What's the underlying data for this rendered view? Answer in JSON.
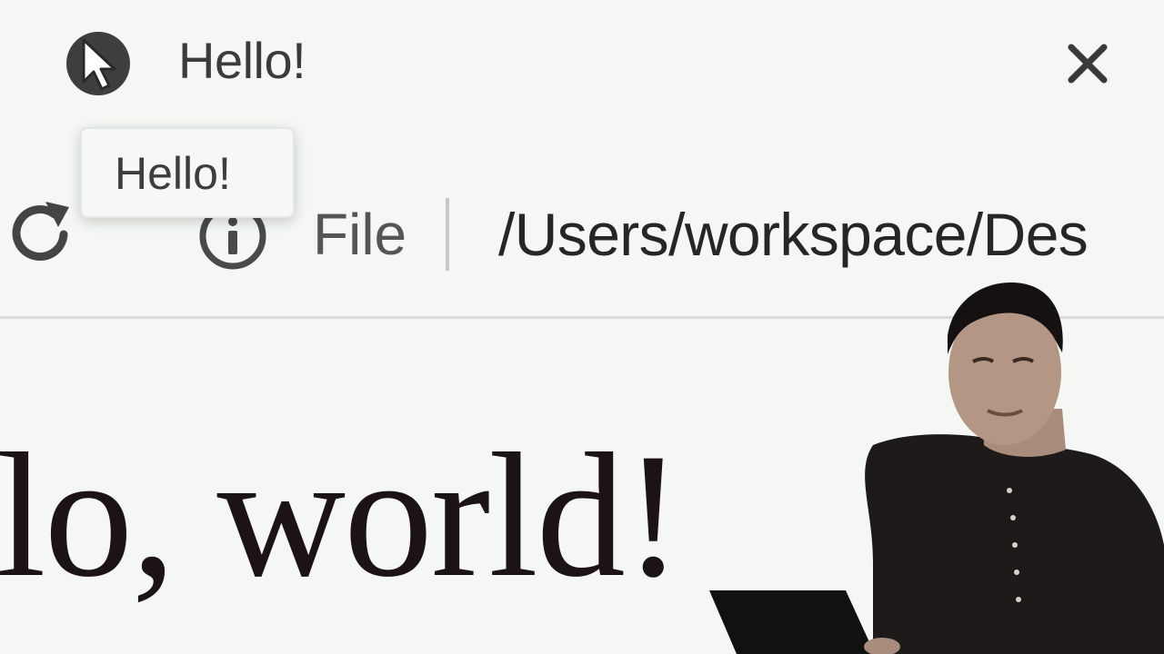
{
  "tab": {
    "title": "Hello!",
    "favicon": "cursor-pointer-icon",
    "close": "close-icon"
  },
  "tooltip": {
    "text": "Hello!"
  },
  "toolbar": {
    "reload": "reload-icon",
    "info": "info-icon",
    "scheme_label": "File",
    "url": "/Users/workspace/Des"
  },
  "page": {
    "heading": "lo, world!"
  },
  "colors": {
    "background": "#f4f7f3",
    "text": "#3a3a3a",
    "heading": "#1c1414",
    "separator": "#d9dcd8"
  }
}
